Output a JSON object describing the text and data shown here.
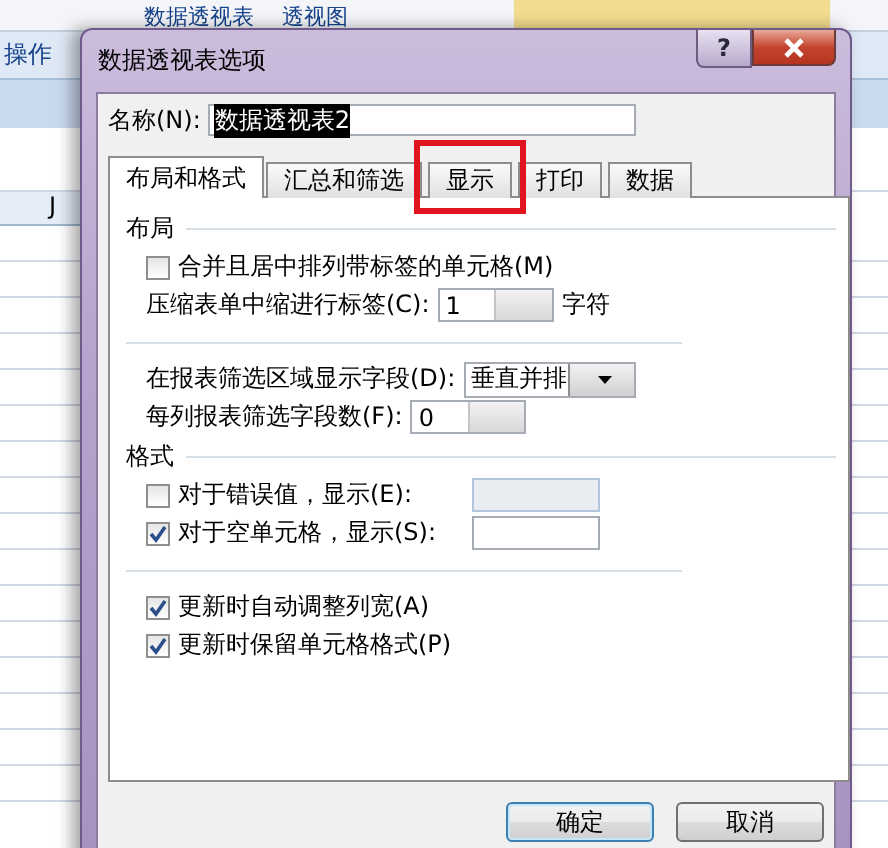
{
  "background": {
    "ribbon_items": [
      "数据透视表",
      "透视图"
    ],
    "group_label": "操作",
    "column_header": "J"
  },
  "dialog": {
    "title": "数据透视表选项",
    "help": "?",
    "name_label": "名称(N):",
    "name_value": "数据透视表2",
    "tabs": [
      {
        "label": "布局和格式",
        "selected": true,
        "highlighted": false
      },
      {
        "label": "汇总和筛选",
        "selected": false,
        "highlighted": false
      },
      {
        "label": "显示",
        "selected": false,
        "highlighted": true
      },
      {
        "label": "打印",
        "selected": false,
        "highlighted": false
      },
      {
        "label": "数据",
        "selected": false,
        "highlighted": false
      }
    ],
    "sections": [
      {
        "title": "布局",
        "rows": [
          {
            "kind": "checkbox",
            "label": "合并且居中排列带标签的单元格(M)",
            "checked": false
          },
          {
            "kind": "spinner",
            "label": "压缩表单中缩进行标签(C):",
            "value": "1",
            "suffix": "字符"
          },
          {
            "kind": "divider"
          },
          {
            "kind": "dropdown",
            "label": "在报表筛选区域显示字段(D):",
            "value": "垂直并排"
          },
          {
            "kind": "spinner",
            "label": "每列报表筛选字段数(F):",
            "value": "0"
          }
        ]
      },
      {
        "title": "格式",
        "rows": [
          {
            "kind": "checkbox_field",
            "label": "对于错误值，显示(E):",
            "checked": false
          },
          {
            "kind": "checkbox_field",
            "label": "对于空单元格，显示(S):",
            "checked": true
          },
          {
            "kind": "divider"
          },
          {
            "kind": "checkbox",
            "label": "更新时自动调整列宽(A)",
            "checked": true
          },
          {
            "kind": "checkbox",
            "label": "更新时保留单元格格式(P)",
            "checked": true
          }
        ]
      }
    ],
    "buttons": [
      {
        "label": "确定",
        "default": true
      },
      {
        "label": "取消",
        "default": false
      }
    ]
  }
}
